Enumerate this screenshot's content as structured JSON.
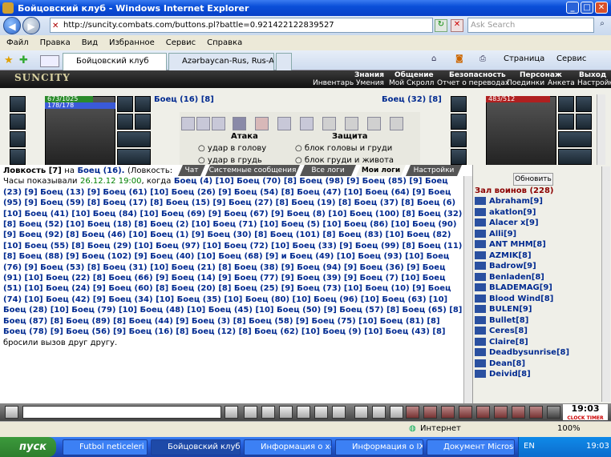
{
  "window": {
    "title": "Бойцовский клуб - Windows Internet Explorer"
  },
  "address": {
    "url": "http://suncity.combats.com/buttons.pl?battle=0.921422122839527",
    "search_placeholder": "Ask Search"
  },
  "menu": [
    "Файл",
    "Правка",
    "Вид",
    "Избранное",
    "Сервис",
    "Справка"
  ],
  "tabs": [
    {
      "label": "Бойцовский клуб"
    },
    {
      "label": "Azərbaycan-Rus, Rus-Azərb..."
    }
  ],
  "toolbar_right": {
    "page": "Страница",
    "tools": "Сервис"
  },
  "game": {
    "logo": "SUNCITY",
    "top_links": [
      "Знания",
      "Общение",
      "Безопасность",
      "Персонаж",
      "Выход"
    ],
    "sub_links": [
      "Инвентарь",
      "Умения",
      "Мой Скролл",
      "Отчет о переводах",
      "Поединки",
      "Анкета",
      "Настройки"
    ],
    "left_fighter": {
      "name": "Боец (16) [8]",
      "hp": "673/1025",
      "mana": "178/178"
    },
    "right_fighter": {
      "name": "Боец (32) [8]",
      "hp": "483/512"
    },
    "attack_title": "Атака",
    "defense_title": "Защита",
    "attack_options": [
      "удар в голову",
      "удар в грудь"
    ],
    "defense_options": [
      "блок головы и груди",
      "блок груди и живота"
    ]
  },
  "chat_tabs": [
    "Чат",
    "Системные сообщения",
    "Все логи",
    "Мои логи",
    "Настройки"
  ],
  "chat": {
    "lead_skill": "Ловкость [7]",
    "lead_on": "на",
    "lead_target": "Боец (16).",
    "lead_rest": "(Ловкость:",
    "line2a": "Часы показывали",
    "date": "26.12.12 19:00",
    "line2b": ", когда",
    "fighters": "Боец (4) [10] Боец (70) [8] Боец (98) [9] Боец (85) [9] Боец (23) [9] Боец (13) [9] Боец (61) [10] Боец (26) [9] Боец (54) [8] Боец (47) [10] Боец (64) [9] Боец (95) [9] Боец (59) [8] Боец (17) [8] Боец (15) [9] Боец (27) [8] Боец (19) [8] Боец (37) [8] Боец (6) [10] Боец (41) [10] Боец (84) [10] Боец (69) [9] Боец (67) [9] Боец (8) [10] Боец (100) [8] Боец (32) [8] Боец (52) [10] Боец (18) [8] Боец (2) [10] Боец (71) [10] Боец (5) [10] Боец (86) [10] Боец (90) [9] Боец (92) [8] Боец (46) [10] Боец (1) [9] Боец (30) [8] Боец (101) [8] Боец (83) [10] Боец (82) [10] Боец (55) [8] Боец (29) [10] Боец (97) [10] Боец (72) [10] Боец (33) [9] Боец (99) [8] Боец (11) [8] Боец (88) [9] Боец (102) [9] Боец (40) [10] Боец (68) [9] и Боец (49) [10] Боец (93) [10] Боец (76) [9] Боец (53) [8] Боец (31) [10] Боец (21) [8] Боец (38) [9] Боец (94) [9] Боец (36) [9] Боец (91) [10] Боец (22) [8] Боец (66) [9] Боец (14) [9] Боец (77) [9] Боец (39) [9] Боец (7) [10] Боец (51) [10] Боец (24) [9] Боец (60) [8] Боец (20) [8] Боец (25) [9] Боец (73) [10] Боец (10) [9] Боец (74) [10] Боец (42) [9] Боец (34) [10] Боец (35) [10] Боец (80) [10] Боец (96) [10] Боец (63) [10] Боец (28) [10] Боец (79) [10] Боец (48) [10] Боец (45) [10] Боец (50) [9] Боец (57) [8] Боец (65) [8] Боец (87) [8] Боец (89) [8] Боец (44) [9] Боец (3) [8] Боец (58) [9] Боец (75) [10] Боец (81) [8] Боец (78) [9] Боец (56) [9] Боец (16) [8] Боец (12) [8] Боец (62) [10] Боец (9) [10] Боец (43) [8]",
    "end": "бросили вызов друг другу."
  },
  "right_panel": {
    "refresh": "Обновить",
    "hall": "Зал воинов (228)",
    "warriors": [
      "Abraham[9]",
      "akatlon[9]",
      "Alacer x[9]",
      "Alli[9]",
      "ANT MHM[8]",
      "AZMIK[8]",
      "Badrow[9]",
      "Benladen[8]",
      "BLADEMAG[9]",
      "Blood Wind[8]",
      "BULEN[9]",
      "Bullet[8]",
      "Ceres[8]",
      "Claire[8]",
      "Deadbysunrise[8]",
      "Dean[8]",
      "Deivid[8]"
    ]
  },
  "clock": {
    "time": "19:03",
    "label": "CLOCK TIMER"
  },
  "status": {
    "zone": "Интернет",
    "zoom": "100%"
  },
  "taskbar": {
    "start": "пуск",
    "tasks": [
      "Futbol neticeleri - G...",
      "Бойцовский клуб - ...",
      "Информация о x-X-...",
      "Информация о IXI-...",
      "Документ Microsoft..."
    ],
    "lang": "EN",
    "time": "19:03"
  }
}
